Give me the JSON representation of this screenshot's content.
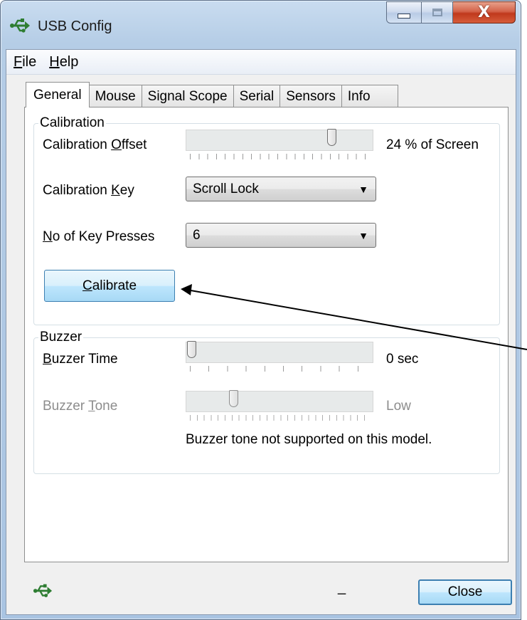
{
  "window": {
    "title": "USB Config",
    "icon": "usb-icon",
    "caption_buttons": [
      "minimize-icon",
      "maximize-icon",
      "close-icon"
    ],
    "close_glyph": "X"
  },
  "menu": {
    "file_accel": "F",
    "file_rest": "ile",
    "help_accel": "H",
    "help_rest": "elp"
  },
  "tabs": [
    "General",
    "Mouse",
    "Signal Scope",
    "Serial",
    "Sensors",
    "Info"
  ],
  "active_tab": "General",
  "calibration": {
    "group_title": "Calibration",
    "offset_label_pre": "Calibration ",
    "offset_label_accel": "O",
    "offset_label_post": "ffset",
    "offset_value": "24 % of Screen",
    "offset_slider_level": 0.76,
    "key_label_pre": "Calibration ",
    "key_label_accel": "K",
    "key_label_post": "ey",
    "key_value": "Scroll Lock",
    "presses_label_accel": "N",
    "presses_label_post": "o of Key Presses",
    "presses_value": "6",
    "button_accel": "C",
    "button_rest": "alibrate"
  },
  "buzzer": {
    "group_title": "Buzzer",
    "time_label_accel": "B",
    "time_label_post": "uzzer Time",
    "time_value": "0 sec",
    "time_slider_level": 0.0,
    "tone_label_pre": "Buzzer ",
    "tone_label_accel": "T",
    "tone_label_post": "one",
    "tone_value": "Low",
    "tone_slider_level": 0.25,
    "note": "Buzzer tone not supported on this model."
  },
  "status": {
    "icon": "usb-icon",
    "text": "_"
  },
  "footer": {
    "close_label": "Close"
  },
  "colors": {
    "titlebar": "#b5cde6",
    "close_button": "#c0391d",
    "default_button": "#bee6fd",
    "accent_border": "#3c7fb1"
  }
}
